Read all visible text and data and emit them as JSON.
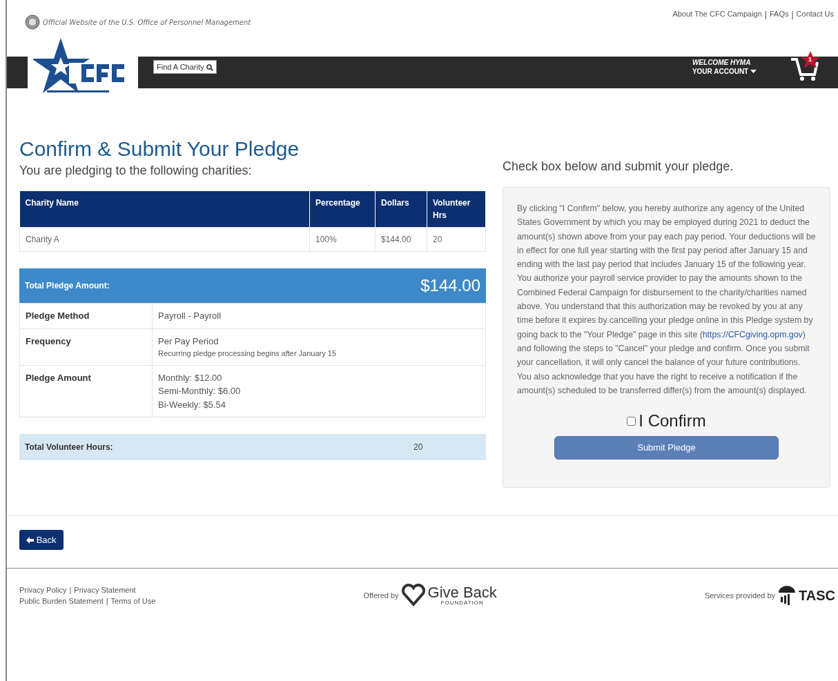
{
  "top_bar": {
    "official_text": "Official Website of the U.S. Office of Personnel Management",
    "links": [
      "About The CFC Campaign",
      "FAQs",
      "Contact Us"
    ],
    "separator": "|"
  },
  "navbar": {
    "search_button": "Find A Charity",
    "welcome": "WELCOME HYMA",
    "account": "YOUR ACCOUNT",
    "cart_count": "1"
  },
  "page_title": "Confirm & Submit Your Pledge",
  "subtitle": "You are pledging to the following charities:",
  "charities_table": {
    "columns": [
      "Charity Name",
      "Percentage",
      "Dollars",
      "Volunteer Hrs"
    ],
    "rows": [
      [
        "Charity A",
        "100%",
        "$144.00",
        "20"
      ]
    ]
  },
  "total_pledge": {
    "label": "Total Pledge Amount:",
    "value": "$144.00"
  },
  "details": [
    {
      "label": "Pledge Method",
      "lines": [
        "Payroll - Payroll"
      ]
    },
    {
      "label": "Frequency",
      "lines": [
        "Per Pay Period"
      ],
      "note": "Recurring pledge processing begins after January 15"
    },
    {
      "label": "Pledge Amount",
      "lines": [
        "Monthly: $12.00",
        "Semi-Monthly: $6.00",
        "Bi-Weekly: $5.54"
      ]
    }
  ],
  "total_volunteer": {
    "label": "Total Volunteer Hours:",
    "value": "20"
  },
  "confirm_panel": {
    "heading": "Check box below and submit your pledge.",
    "disclaimer_before": "By clicking \"I Confirm\" below, you hereby authorize any agency of the United States Government by which you may be employed during 2021 to deduct the amount(s) shown above from your pay each pay period. Your deductions will be in effect for one full year starting with the first pay period after January 15 and ending with the last pay period that includes January 15 of the following year. You authorize your payroll service provider to pay the amounts shown to the Combined Federal Campaign for disbursement to the charity/charities named above. You understand that this authorization may be revoked by you at any time before it expires by cancelling your pledge online in this Pledge system by going back to the \"Your Pledge\" page in this site (",
    "disclaimer_link": "https://CFCgiving.opm.gov",
    "disclaimer_after": ") and following the steps to \"Cancel\" your pledge and confirm. Once you submit your cancellation, it will only cancel the balance of your future contributions. You also acknowledge that you have the right to receive a notification if the amount(s) scheduled to be transferred differ(s) from the amount(s) displayed.",
    "confirm_label": "I Confirm",
    "checked": false,
    "submit": "Submit Pledge"
  },
  "back_button": "Back",
  "footer": {
    "separator": "|",
    "links_line1": [
      "Privacy Policy",
      "Privacy Statement"
    ],
    "links_line2": [
      "Public Burden Statement",
      "Terms of Use"
    ],
    "offered_by": "Offered by",
    "give_back": "Give Back",
    "foundation": "FOUNDATION",
    "services": "Services provided by",
    "tasc": "TASC"
  }
}
